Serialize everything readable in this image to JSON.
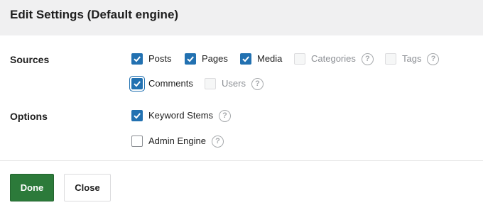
{
  "header": {
    "title": "Edit Settings (Default engine)"
  },
  "sources": {
    "label": "Sources",
    "items": [
      {
        "label": "Posts",
        "checked": true,
        "disabled": false
      },
      {
        "label": "Pages",
        "checked": true,
        "disabled": false
      },
      {
        "label": "Media",
        "checked": true,
        "disabled": false
      },
      {
        "label": "Categories",
        "checked": false,
        "disabled": true
      },
      {
        "label": "Tags",
        "checked": false,
        "disabled": true
      },
      {
        "label": "Comments",
        "checked": true,
        "disabled": false
      },
      {
        "label": "Users",
        "checked": false,
        "disabled": true
      }
    ]
  },
  "options": {
    "label": "Options",
    "items": [
      {
        "label": "Keyword Stems",
        "checked": true
      },
      {
        "label": "Admin Engine",
        "checked": false
      }
    ]
  },
  "help_symbol": "?",
  "footer": {
    "done_label": "Done",
    "close_label": "Close"
  },
  "colors": {
    "accent": "#2271b1",
    "done": "#2c7a3a",
    "header_bg": "#f0f0f1"
  }
}
